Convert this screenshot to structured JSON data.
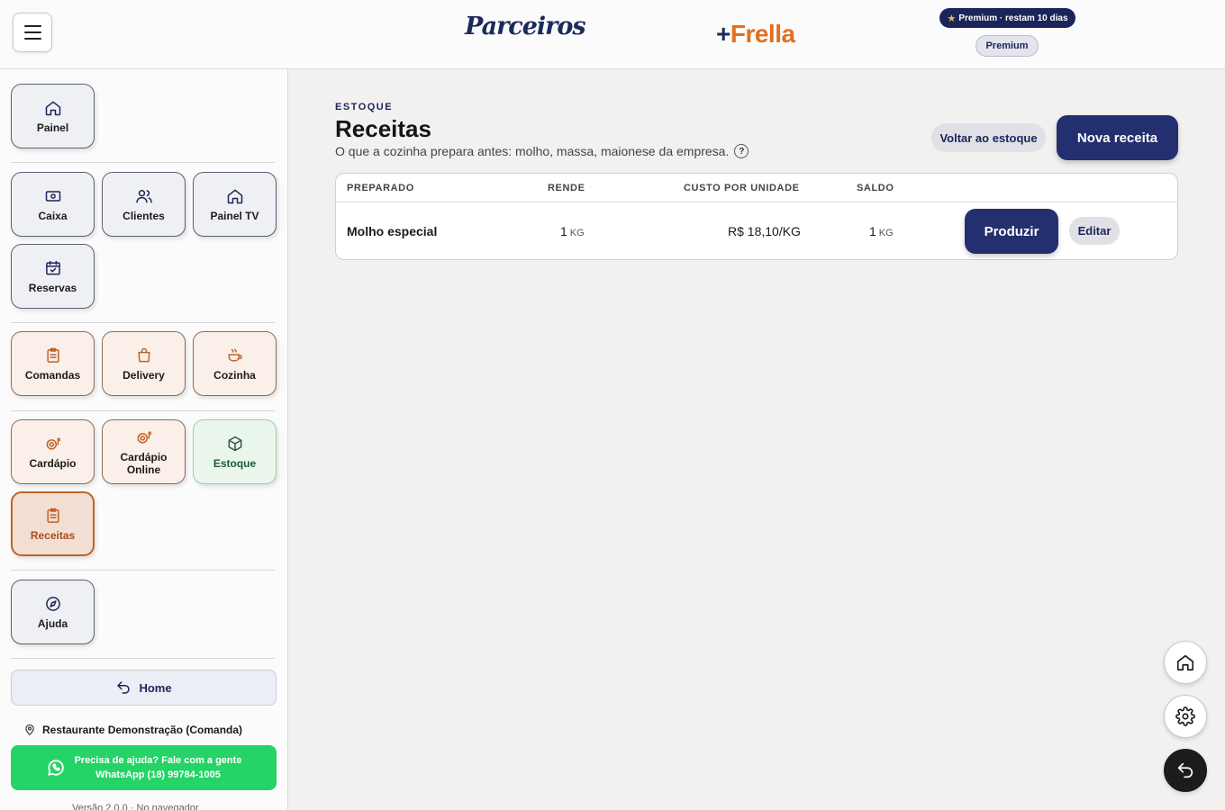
{
  "header": {
    "logo_left": "Parceiros",
    "logo_right_plus": "+",
    "logo_right": "Frella",
    "premium_pill": "Premium · restam 10 dias",
    "premium_badge": "Premium"
  },
  "sidebar": {
    "tiles": {
      "painel": "Painel",
      "caixa": "Caixa",
      "clientes": "Clientes",
      "painel_tv": "Painel TV",
      "reservas": "Reservas",
      "comandas": "Comandas",
      "delivery": "Delivery",
      "cozinha": "Cozinha",
      "cardapio": "Cardápio",
      "cardapio_online": "Cardápio Online",
      "estoque": "Estoque",
      "receitas": "Receitas",
      "ajuda": "Ajuda"
    },
    "home_label": "Home",
    "restaurant": "Restaurante Demonstração (Comanda)",
    "whatsapp_line1": "Precisa de ajuda? Fale com a gente",
    "whatsapp_line2": "WhatsApp (18) 99784-1005",
    "version": "Versão 2.0.0 · No navegador"
  },
  "main": {
    "eyebrow": "ESTOQUE",
    "title": "Receitas",
    "subtitle": "O que a cozinha prepara antes: molho, massa, maionese da empresa.",
    "help_symbol": "?",
    "back_button": "Voltar ao estoque",
    "new_button": "Nova receita",
    "table": {
      "headers": {
        "preparado": "PREPARADO",
        "rende": "RENDE",
        "custo": "CUSTO POR UNIDADE",
        "saldo": "SALDO"
      },
      "rows": [
        {
          "name": "Molho especial",
          "rende_value": "1",
          "rende_unit": "KG",
          "custo": "R$ 18,10/KG",
          "saldo_value": "1",
          "saldo_unit": "KG",
          "produce_label": "Produzir",
          "edit_label": "Editar"
        }
      ]
    }
  },
  "icons": {
    "menu": "hamburger-icon",
    "fab_home": "home-icon",
    "fab_settings": "gear-icon",
    "fab_back": "undo-icon"
  },
  "colors": {
    "primary": "#232f6e",
    "accent": "#e0701f",
    "whatsapp": "#25d366",
    "active_tile_border": "#c0632a"
  }
}
